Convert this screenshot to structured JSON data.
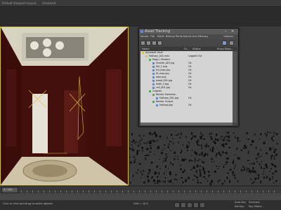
{
  "topbar": {
    "left": "Default Viewport Layout",
    "right": "Unnamed"
  },
  "dialog": {
    "title": "Asset Tracking",
    "menu": [
      "Server",
      "File",
      "Paths",
      "Bitmap Performance and Memory",
      "Options"
    ],
    "columns": [
      "Name",
      "Fu...",
      "Status",
      "Proxy Reso..."
    ],
    "rows": [
      {
        "name": "Autodesk Vault",
        "status": "",
        "indent": 0,
        "color": "#e0c040"
      },
      {
        "name": "Hallway_001.max",
        "status": "Logged Out",
        "indent": 1,
        "color": "#e0c040"
      },
      {
        "name": "Maps / Shaders",
        "status": "",
        "indent": 2,
        "color": "#4caf50"
      },
      {
        "name": "Granite_003.jpg",
        "status": "Ok",
        "indent": 3,
        "color": "#5b8bd6"
      },
      {
        "name": "tile_1.png",
        "status": "Ok",
        "indent": 3,
        "color": "#5b8bd6"
      },
      {
        "name": "frd_map.jpg",
        "status": "Ok",
        "indent": 3,
        "color": "#5b8bd6"
      },
      {
        "name": "flr_map.jpg",
        "status": "Ok",
        "indent": 3,
        "color": "#5b8bd6"
      },
      {
        "name": "door.png",
        "status": "Ok",
        "indent": 3,
        "color": "#5b8bd6"
      },
      {
        "name": "wood_005.jpg",
        "status": "Ok",
        "indent": 3,
        "color": "#5b8bd6"
      },
      {
        "name": "leath_2.jpg",
        "status": "Ok",
        "indent": 3,
        "color": "#5b8bd6"
      },
      {
        "name": "ceil_001.jpg",
        "status": "Ok",
        "indent": 3,
        "color": "#5b8bd6"
      },
      {
        "name": "Outputs",
        "status": "",
        "indent": 2,
        "color": "#4caf50"
      },
      {
        "name": "Render Elements",
        "status": "",
        "indent": 3,
        "color": "#4caf50"
      },
      {
        "name": "Hallway_001.jpg",
        "status": "Ok",
        "indent": 4,
        "color": "#5b8bd6"
      },
      {
        "name": "Render Output",
        "status": "",
        "indent": 3,
        "color": "#4caf50"
      },
      {
        "name": "Hallway.jpg",
        "status": "Ok",
        "indent": 4,
        "color": "#5b8bd6"
      }
    ]
  },
  "timeline": {
    "counter": "0 / 100"
  },
  "status": {
    "left": "Click or click-and-drag to select objects",
    "grid": "Grid = 10.0",
    "autokey": "Auto Key",
    "setkey": "Set Key",
    "selected": "Selected",
    "keyfilters": "Key Filters..."
  },
  "colors": {
    "accent": "#d8c040"
  }
}
